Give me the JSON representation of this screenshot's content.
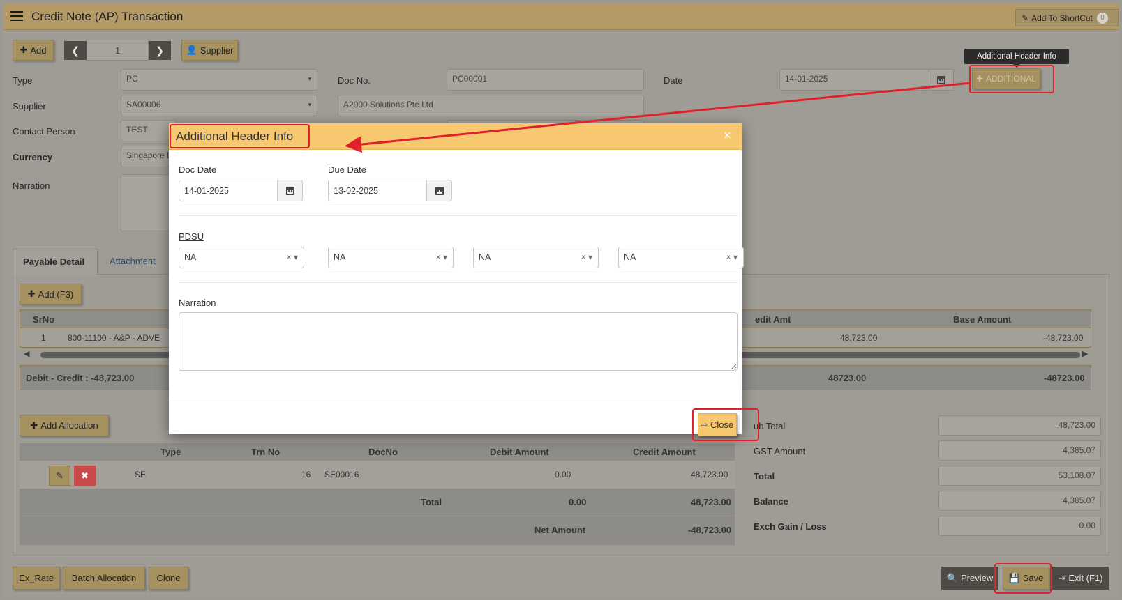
{
  "header": {
    "title": "Credit Note (AP) Transaction",
    "shortcut_label": "Add To ShortCut",
    "shortcut_count": "0"
  },
  "toolbar": {
    "add_label": "Add",
    "page_number": "1",
    "supplier_label": "Supplier"
  },
  "tooltip": {
    "text": "Additional Header Info"
  },
  "form": {
    "type_label": "Type",
    "type_value": "PC",
    "docno_label": "Doc No.",
    "docno_value": "PC00001",
    "date_label": "Date",
    "date_value": "14-01-2025",
    "additional_label": "ADDITIONAL",
    "supplier_label": "Supplier",
    "supplier_value": "SA00006",
    "supplier_name": "A2000 Solutions Pte Ltd",
    "contact_label": "Contact Person",
    "contact_value": "TEST",
    "currency_label": "Currency",
    "currency_value": "Singapore D",
    "narration_label": "Narration"
  },
  "tabs": [
    {
      "label": "Payable Detail"
    },
    {
      "label": "Attachment"
    }
  ],
  "detail": {
    "add_label": "Add (F3)",
    "col_srno": "SrNo",
    "col_credit_amt": "edit Amt",
    "col_base_amount": "Base Amount",
    "row": {
      "srno": "1",
      "account": "800-11100 - A&P - ADVE",
      "credit_amt": "48,723.00",
      "base_amount": "-48,723.00"
    },
    "summary_text": "Debit - Credit : -48,723.00",
    "summary_credit": "48723.00",
    "summary_base": "-48723.00"
  },
  "allocation": {
    "add_label": "Add Allocation",
    "col_type": "Type",
    "col_trn_no": "Trn No",
    "col_docno": "DocNo",
    "col_debit": "Debit Amount",
    "col_credit": "Credit Amount",
    "row": {
      "type": "SE",
      "trn_no": "16",
      "docno": "SE00016",
      "debit": "0.00",
      "credit": "48,723.00"
    },
    "total_label": "Total",
    "total_debit": "0.00",
    "total_credit": "48,723.00",
    "net_label": "Net Amount",
    "net_value": "-48,723.00"
  },
  "totals": {
    "subtotal_label": "ub Total",
    "subtotal_value": "48,723.00",
    "gst_label": "GST Amount",
    "gst_value": "4,385.07",
    "total_label": "Total",
    "total_value": "53,108.07",
    "balance_label": "Balance",
    "balance_value": "4,385.07",
    "exch_label": "Exch Gain / Loss",
    "exch_value": "0.00"
  },
  "footer": {
    "ex_rate": "Ex_Rate",
    "batch_allocation": "Batch Allocation",
    "clone": "Clone",
    "preview": "Preview",
    "save": "Save",
    "exit": "Exit (F1)"
  },
  "modal": {
    "title": "Additional Header Info",
    "close_x": "×",
    "doc_date_label": "Doc Date",
    "doc_date_value": "14-01-2025",
    "due_date_label": "Due Date",
    "due_date_value": "13-02-2025",
    "pdsu_label": "PDSU",
    "selects": [
      {
        "value": "NA"
      },
      {
        "value": "NA"
      },
      {
        "value": "NA"
      },
      {
        "value": "NA"
      }
    ],
    "narration_label": "Narration",
    "close_label": "Close"
  },
  "colors": {
    "header_bar": "#b39a67",
    "modal_header": "#f7c86f",
    "accent_gold": "#f7c86f",
    "annotation_red": "#e0202a",
    "delete_red": "#c84a4a"
  }
}
